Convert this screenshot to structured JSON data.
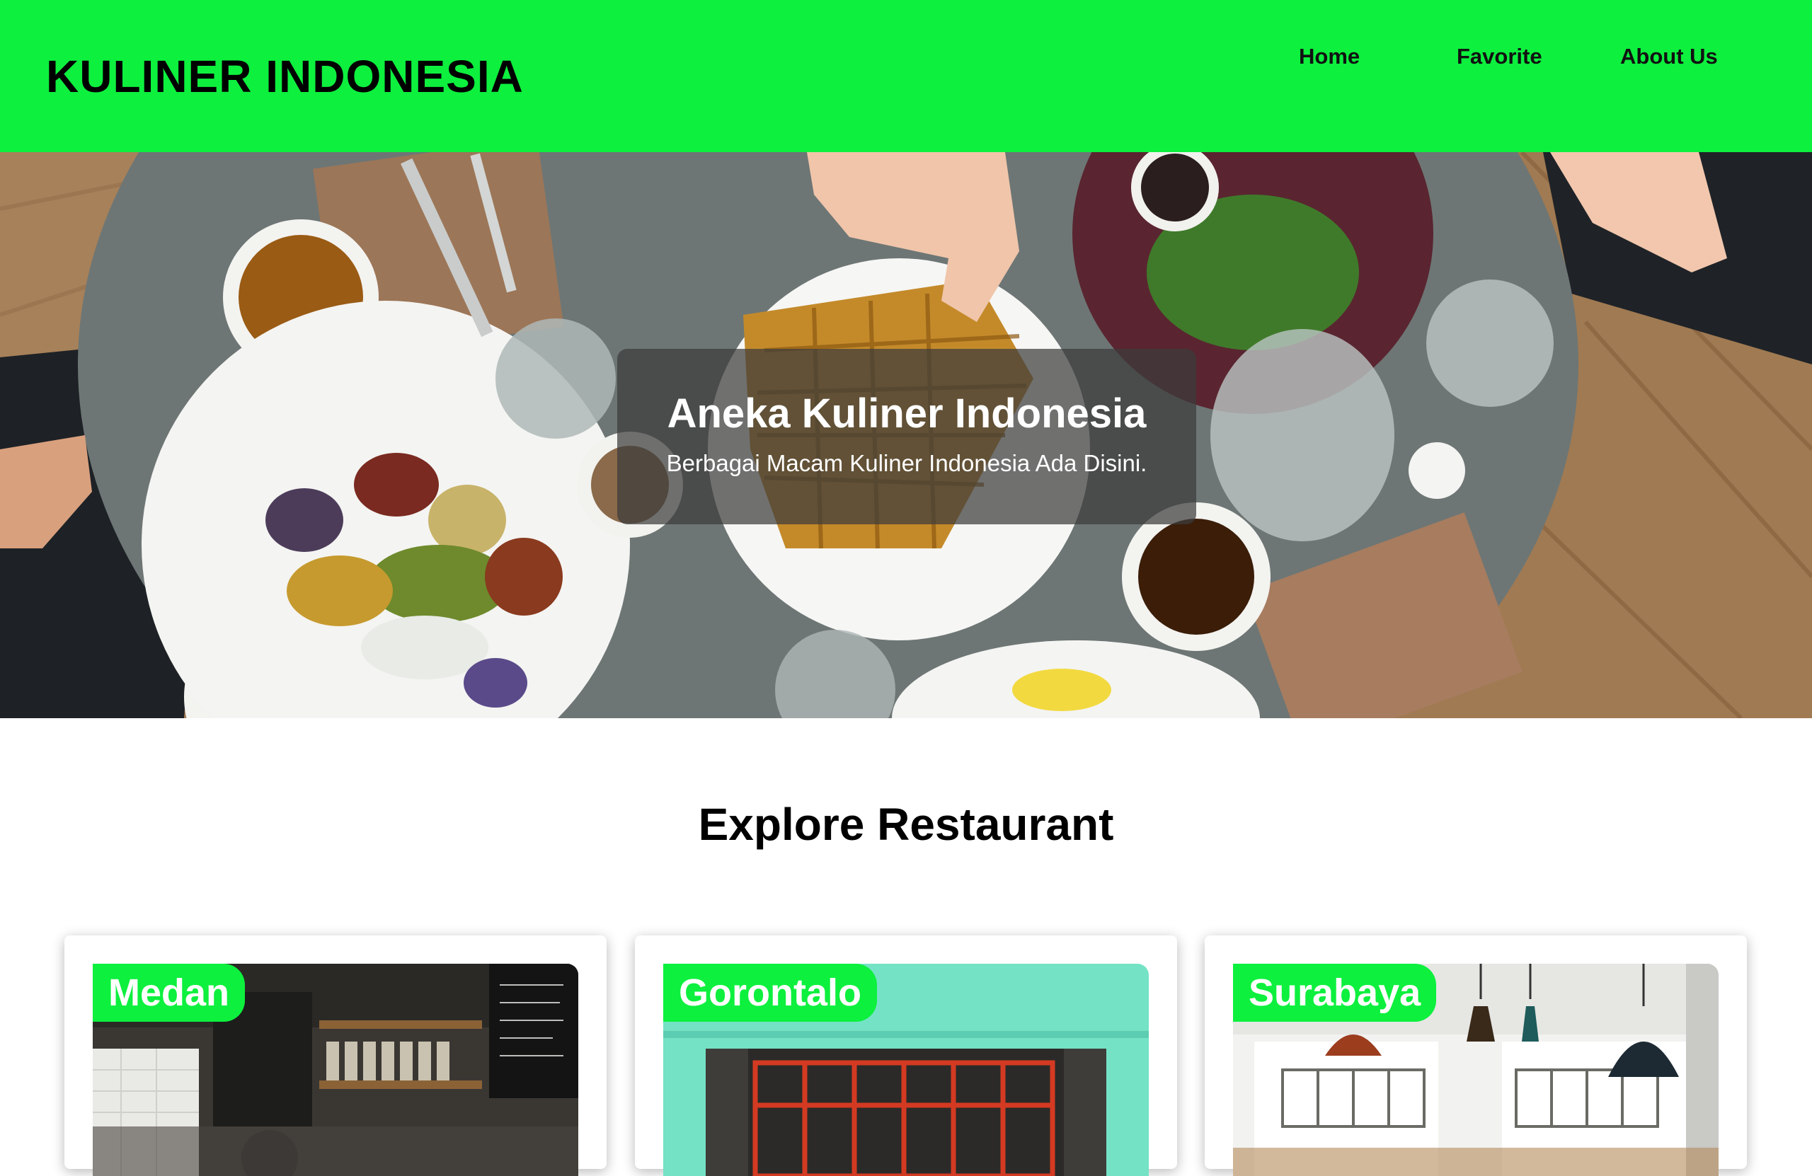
{
  "header": {
    "title": "KULINER INDONESIA",
    "nav": [
      {
        "label": "Home"
      },
      {
        "label": "Favorite"
      },
      {
        "label": "About Us"
      }
    ]
  },
  "hero": {
    "title": "Aneka Kuliner Indonesia",
    "subtitle": "Berbagai Macam Kuliner Indonesia Ada Disini."
  },
  "explore": {
    "heading": "Explore Restaurant",
    "restaurants": [
      {
        "city": "Medan"
      },
      {
        "city": "Gorontalo"
      },
      {
        "city": "Surabaya"
      }
    ]
  },
  "colors": {
    "accent": "#0df03e",
    "text": "#000000",
    "overlay": "#3c3c3c"
  }
}
